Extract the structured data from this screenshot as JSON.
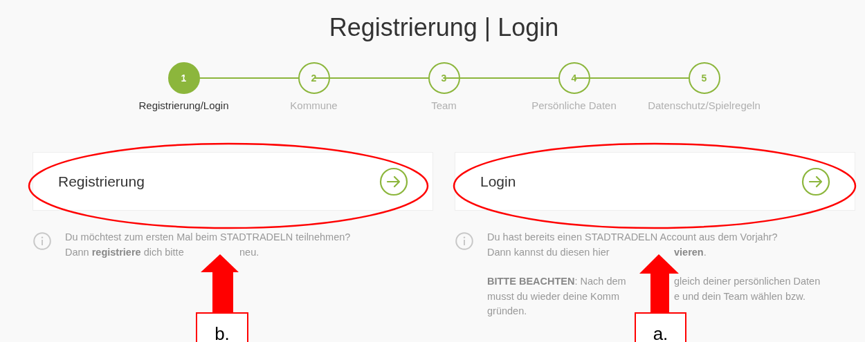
{
  "title": "Registrierung | Login",
  "steps": [
    {
      "number": "1",
      "label": "Registrierung/Login",
      "selected": true
    },
    {
      "number": "2",
      "label": "Kommune",
      "selected": false
    },
    {
      "number": "3",
      "label": "Team",
      "selected": false
    },
    {
      "number": "4",
      "label": "Persönliche Daten",
      "selected": false
    },
    {
      "number": "5",
      "label": "Datenschutz/Spielregeln",
      "selected": false
    }
  ],
  "options": [
    {
      "label": "Registrierung",
      "info": [
        {
          "lines": [
            [
              "Du möchtest zum ersten Mal beim STADTRADELN teilnehmen?"
            ],
            [
              "Dann **registriere** dich bitte",
              "neu."
            ]
          ]
        }
      ]
    },
    {
      "label": "Login",
      "info": [
        {
          "lines": [
            [
              "Du hast bereits einen STADTRADELN Account aus dem Vorjahr?"
            ],
            [
              "Dann kannst du diesen hier",
              "**vieren**."
            ]
          ]
        },
        {
          "lines": [
            [
              "**BITTE BEACHTEN**: Nach dem",
              "gleich deiner persönlichen Daten"
            ],
            [
              "musst du wieder deine Komm",
              "e und dein Team wählen bzw."
            ],
            [
              "gründen."
            ]
          ]
        }
      ]
    }
  ],
  "annotations": [
    {
      "label": "b."
    },
    {
      "label": "a."
    }
  ]
}
